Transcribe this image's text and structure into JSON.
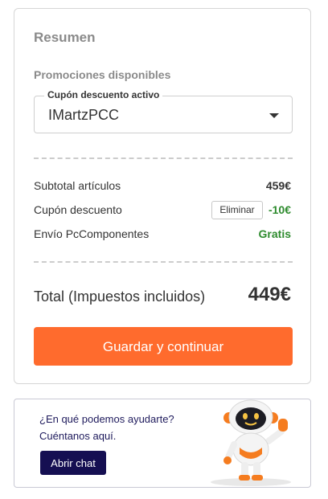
{
  "summary": {
    "title": "Resumen",
    "promotions_title": "Promociones disponibles",
    "coupon": {
      "label": "Cupón descuento activo",
      "value": "IMartzPCC"
    },
    "rows": [
      {
        "label": "Subtotal artículos",
        "value": "459€"
      },
      {
        "label": "Cupón descuento",
        "value": "-10€",
        "action": "Eliminar"
      },
      {
        "label": "Envío PcComponentes",
        "value": "Gratis"
      }
    ],
    "total": {
      "label": "Total (Impuestos incluidos)",
      "value": "449€"
    },
    "continue_button": "Guardar y continuar"
  },
  "help": {
    "line1": "¿En qué podemos ayudarte?",
    "line2": "Cuéntanos aquí.",
    "chat_button": "Abrir chat",
    "illustration": "robot-mascot-waving"
  },
  "colors": {
    "accent": "#ff6b2d",
    "positive": "#2e8b2e",
    "navy": "#150f52",
    "muted_heading": "#8a8a8a"
  }
}
